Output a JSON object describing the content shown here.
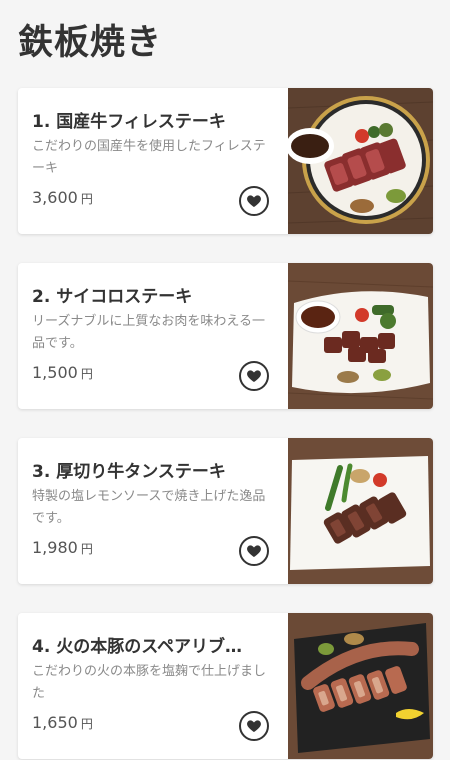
{
  "page": {
    "title": "鉄板焼き"
  },
  "menu_items": [
    {
      "title": "1. 国産牛フィレステーキ",
      "description": "こだわりの国産牛を使用したフィレステーキ",
      "price": "3,600",
      "currency": "円",
      "photo_icon": "fillet-steak-photo"
    },
    {
      "title": "2. サイコロステーキ",
      "description": "リーズナブルに上質なお肉を味わえる一品です。",
      "price": "1,500",
      "currency": "円",
      "photo_icon": "dice-steak-photo"
    },
    {
      "title": "3. 厚切り牛タンステーキ",
      "description": "特製の塩レモンソースで焼き上げた逸品です。",
      "price": "1,980",
      "currency": "円",
      "photo_icon": "beef-tongue-photo"
    },
    {
      "title": "4. 火の本豚のスペアリブ…",
      "description": "こだわりの火の本豚を塩麹で仕上げました",
      "price": "1,650",
      "currency": "円",
      "photo_icon": "spare-rib-photo"
    }
  ],
  "colors": {
    "background": "#f5f5f5",
    "card": "#ffffff",
    "text": "#333333",
    "muted": "#8a8a8a",
    "wood": "#6b4a36"
  }
}
